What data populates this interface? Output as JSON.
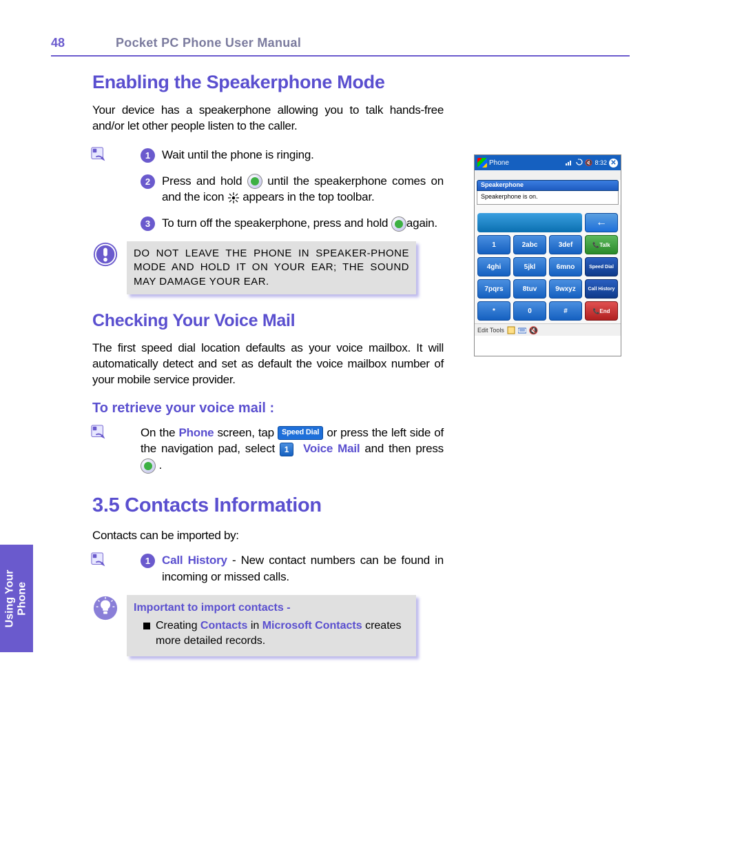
{
  "page_number": "48",
  "page_title": "Pocket PC Phone User Manual",
  "side_tab": "Using Your\nPhone",
  "h1_speakerphone": "Enabling the Speakerphone Mode",
  "speakerphone_intro": "Your device has a speakerphone allowing you to talk hands-free and/or let other people listen to the caller.",
  "steps": {
    "s1": "Wait  until  the phone is ringing.",
    "s2a": "Press  and  hold  ",
    "s2b": "  until  the  speakerphone comes on and the icon ",
    "s2c": "  appears in the top toolbar.",
    "s3a": "To turn off the speakerphone, press and hold ",
    "s3b": "again."
  },
  "warning_text": "DO NOT LEAVE THE PHONE IN SPEAKER-PHONE MODE AND HOLD IT ON YOUR EAR; THE SOUND MAY DAMAGE YOUR EAR.",
  "h2_voicemail": "Checking Your Voice Mail",
  "voicemail_intro": "The first speed dial location defaults as your voice mailbox. It will automatically detect and set as default  the voice mailbox number of your mobile service provider.",
  "h3_retrieve": "To retrieve your voice mail :",
  "retrieve": {
    "a": "On the ",
    "phone": "Phone",
    "b": " screen, tap  ",
    "speed_dial_btn": "Speed Dial",
    "c": " or press the left side of the navigation pad, select  ",
    "num1": "1",
    "voice_mail": "Voice Mail",
    "d": " and then press  ",
    "e": " ."
  },
  "h_section": "3.5 Contacts Information",
  "contacts_intro": "Contacts can be imported by:",
  "contacts_step1a": "Call History",
  "contacts_step1b": " - New contact numbers can be found in incoming or missed calls.",
  "tip_title": "Important to import contacts -",
  "tip_a": "Creating ",
  "tip_contacts": "Contacts",
  "tip_b": " in ",
  "tip_ms": "Microsoft Contacts",
  "tip_c": " creates more detailed records.",
  "device": {
    "title": "Phone",
    "time": "8:32",
    "strip": "",
    "popup_head": "Speakerphone",
    "popup_body": "Speakerphone is on.",
    "keys": {
      "clear": "",
      "back": "←",
      "k1": "1",
      "k2": "2abc",
      "k3": "3def",
      "talk": "Talk",
      "k4": "4ghi",
      "k5": "5jkl",
      "k6": "6mno",
      "spd": "Speed Dial",
      "k7": "7pqrs",
      "k8": "8tuv",
      "k9": "9wxyz",
      "hist": "Call History",
      "kstar": "*",
      "k0": "0",
      "khash": "#",
      "end": "End"
    },
    "bottom": "Edit Tools"
  }
}
